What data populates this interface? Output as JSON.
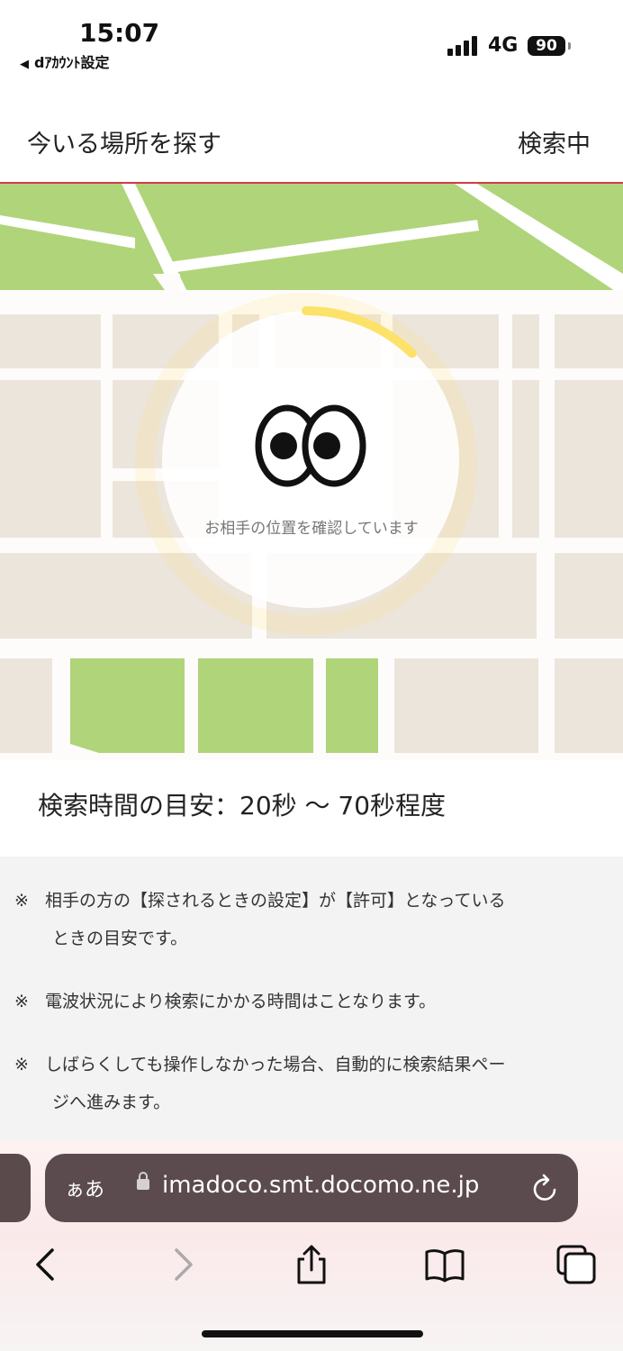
{
  "status_bar": {
    "time": "15:07",
    "back_app": "dｱｶｳﾝﾄ設定",
    "network": "4G",
    "battery": "90"
  },
  "header": {
    "title": "今いる場所を探す",
    "state": "検索中"
  },
  "map": {
    "locating_message": "お相手の位置を確認しています",
    "progress_ring_color": "#fde26a",
    "park_color": "#b0d479",
    "block_color": "#ece5dc",
    "icon": "eyes-icon"
  },
  "estimate": "検索時間の目安：20秒 ～ 70秒程度",
  "notes": [
    {
      "mark": "※",
      "line1": "相手の方の【探されるときの設定】が【許可】となっている",
      "line2": "ときの目安です。"
    },
    {
      "mark": "※",
      "line1": "電波状況により検索にかかる時間はことなります。",
      "line2": ""
    },
    {
      "mark": "※",
      "line1": "しばらくしても操作しなかった場合、自動的に検索結果ペー",
      "line2": "ジへ進みます。"
    }
  ],
  "browser": {
    "aa_label": "ぁあ",
    "url": "imadoco.smt.docomo.ne.jp"
  }
}
